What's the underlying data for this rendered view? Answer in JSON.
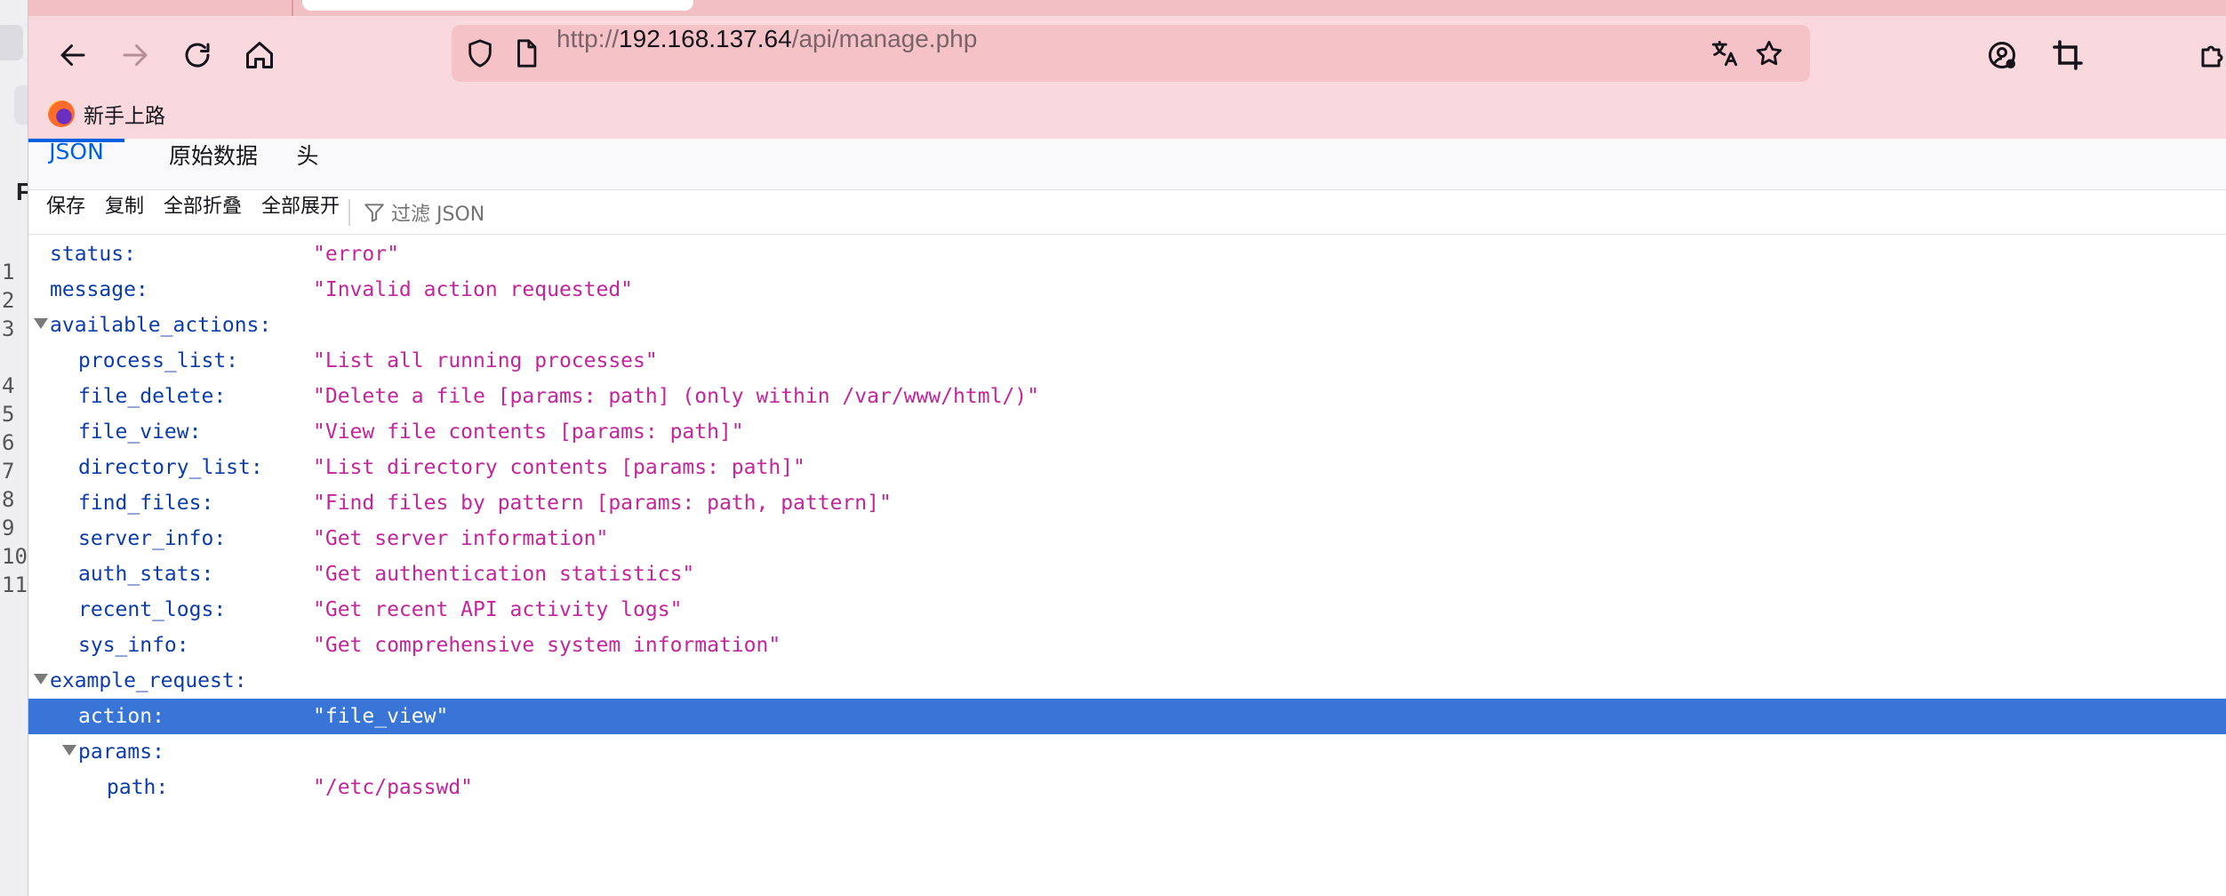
{
  "background_window": {
    "letter": "F",
    "line_numbers": [
      "1",
      "2",
      "3",
      "",
      "4",
      "5",
      "6",
      "7",
      "8",
      "9",
      "10",
      "11"
    ]
  },
  "browser": {
    "url": {
      "scheme": "http://",
      "host": "192.168.137.64",
      "path": "/api/manage.php"
    },
    "bookmark_label": "新手上路"
  },
  "viewer": {
    "tabs": [
      {
        "label": "JSON",
        "active": true
      },
      {
        "label": "原始数据",
        "active": false
      },
      {
        "label": "头",
        "active": false
      }
    ],
    "toolbar": {
      "save": "保存",
      "copy": "复制",
      "collapse_all": "全部折叠",
      "expand_all": "全部展开",
      "filter_placeholder": "过滤 JSON"
    }
  },
  "json_tree": [
    {
      "key": "status:",
      "value": "\"error\"",
      "depth": 0,
      "expandable": false
    },
    {
      "key": "message:",
      "value": "\"Invalid action requested\"",
      "depth": 0,
      "expandable": false
    },
    {
      "key": "available_actions:",
      "value": "",
      "depth": 0,
      "expandable": true
    },
    {
      "key": "process_list:",
      "value": "\"List all running processes\"",
      "depth": 1,
      "expandable": false
    },
    {
      "key": "file_delete:",
      "value": "\"Delete a file [params: path] (only within /var/www/html/)\"",
      "depth": 1,
      "expandable": false
    },
    {
      "key": "file_view:",
      "value": "\"View file contents [params: path]\"",
      "depth": 1,
      "expandable": false
    },
    {
      "key": "directory_list:",
      "value": "\"List directory contents [params: path]\"",
      "depth": 1,
      "expandable": false
    },
    {
      "key": "find_files:",
      "value": "\"Find files by pattern [params: path, pattern]\"",
      "depth": 1,
      "expandable": false
    },
    {
      "key": "server_info:",
      "value": "\"Get server information\"",
      "depth": 1,
      "expandable": false
    },
    {
      "key": "auth_stats:",
      "value": "\"Get authentication statistics\"",
      "depth": 1,
      "expandable": false
    },
    {
      "key": "recent_logs:",
      "value": "\"Get recent API activity logs\"",
      "depth": 1,
      "expandable": false
    },
    {
      "key": "sys_info:",
      "value": "\"Get comprehensive system information\"",
      "depth": 1,
      "expandable": false
    },
    {
      "key": "example_request:",
      "value": "",
      "depth": 0,
      "expandable": true
    },
    {
      "key": "action:",
      "value": "\"file_view\"",
      "depth": 1,
      "expandable": false,
      "selected": true
    },
    {
      "key": "params:",
      "value": "",
      "depth": 1,
      "expandable": true
    },
    {
      "key": "path:",
      "value": "\"/etc/passwd\"",
      "depth": 2,
      "expandable": false
    }
  ],
  "colors": {
    "toolbar_bg": "#f9d9dd",
    "urlbar_bg": "#f4c2c7",
    "key": "#0c3daa",
    "string": "#c3259b",
    "selection": "#3875d7",
    "active_tab": "#0060df"
  }
}
